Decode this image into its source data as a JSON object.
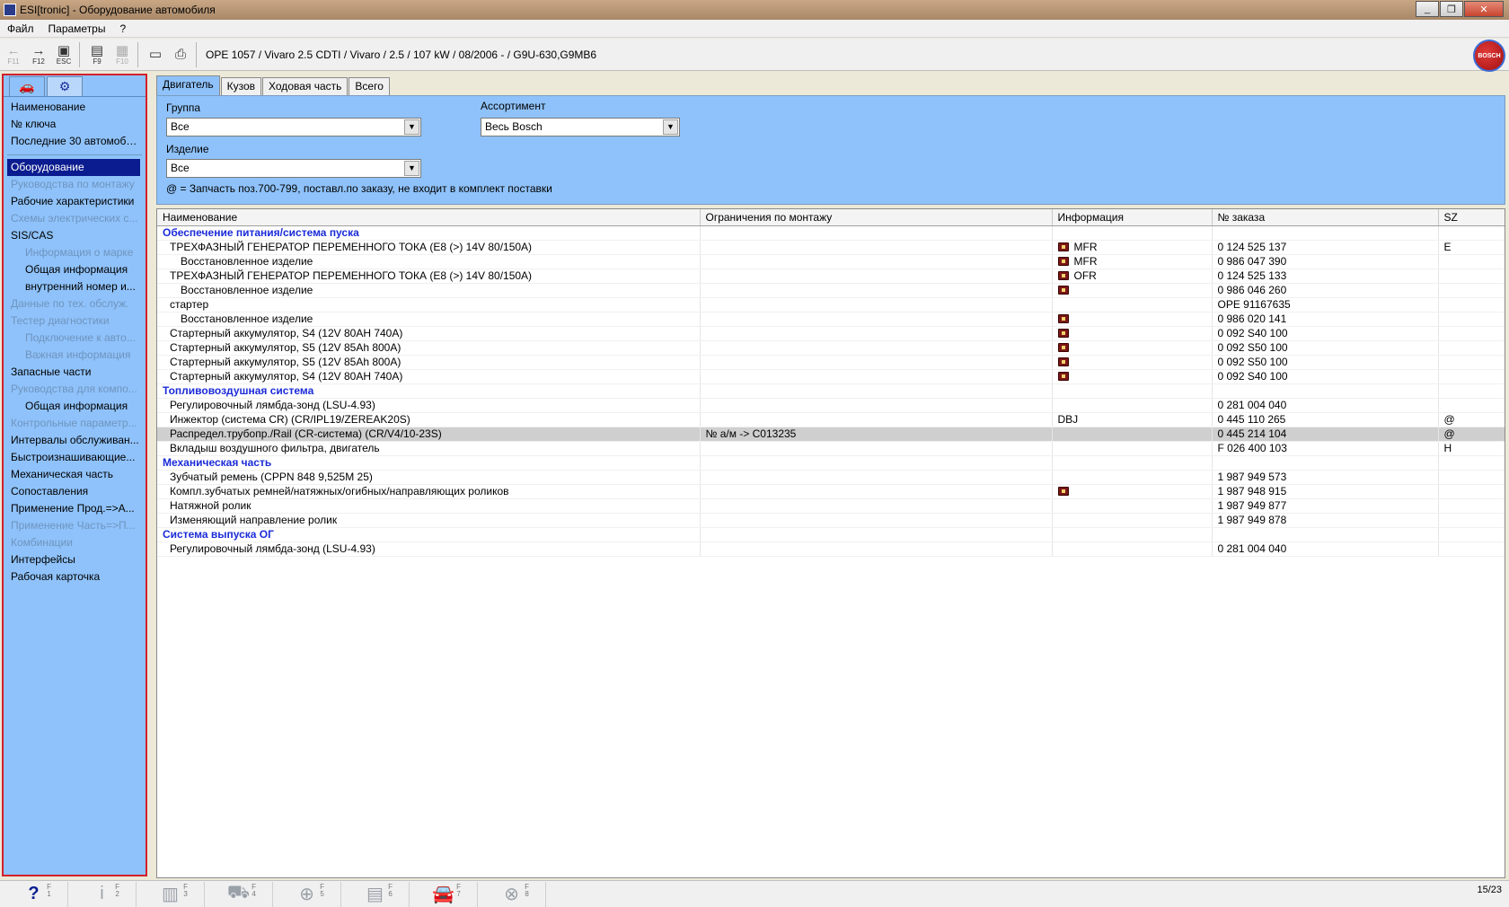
{
  "window": {
    "title": "ESI[tronic] - Оборудование автомобиля",
    "min": "_",
    "max": "❐",
    "close": "✕"
  },
  "menu": [
    "Файл",
    "Параметры",
    "?"
  ],
  "toolbar": {
    "buttons": [
      {
        "glyph": "←",
        "label": "F11",
        "disabled": true
      },
      {
        "glyph": "→",
        "label": "F12",
        "disabled": false
      },
      {
        "glyph": "▣",
        "label": "ESC",
        "disabled": false
      },
      {
        "glyph": "▤",
        "label": "F9",
        "disabled": false
      },
      {
        "glyph": "▦",
        "label": "F10",
        "disabled": true
      },
      {
        "glyph": "▭",
        "label": "",
        "disabled": false
      },
      {
        "glyph": "⎙",
        "label": "",
        "disabled": false
      }
    ],
    "vehicle": "OPE 1057 / Vivaro 2.5 CDTI / Vivaro / 2.5 / 107 kW / 08/2006 -  / G9U-630,G9MB6",
    "logo": "BOSCH"
  },
  "left_nav": {
    "tabs": [
      {
        "icon": "car-icon",
        "glyph": "🚗"
      },
      {
        "icon": "engine-icon",
        "glyph": "⚙"
      }
    ],
    "items_top": [
      {
        "label": "Наименование",
        "state": "normal"
      },
      {
        "label": "№ ключа",
        "state": "normal"
      },
      {
        "label": "Последние 30 автомоби...",
        "state": "normal"
      }
    ],
    "items": [
      {
        "label": "Оборудование",
        "state": "selected"
      },
      {
        "label": "Руководства по монтажу",
        "state": "disabled"
      },
      {
        "label": "Рабочие характеристики",
        "state": "normal"
      },
      {
        "label": "Схемы электрических с...",
        "state": "disabled"
      },
      {
        "label": "SIS/CAS",
        "state": "normal"
      },
      {
        "label": "Информация о марке",
        "state": "disabled",
        "sub": true
      },
      {
        "label": "Общая информация",
        "state": "normal",
        "sub": true
      },
      {
        "label": "внутренний номер и...",
        "state": "normal",
        "sub": true
      },
      {
        "label": "Данные по тех. обслуж.",
        "state": "disabled"
      },
      {
        "label": "Тестер диагностики",
        "state": "disabled"
      },
      {
        "label": "Подключение к авто...",
        "state": "disabled",
        "sub": true
      },
      {
        "label": "Важная информация",
        "state": "disabled",
        "sub": true
      },
      {
        "label": "Запасные части",
        "state": "normal"
      },
      {
        "label": "Руководства для компо...",
        "state": "disabled"
      },
      {
        "label": "Общая информация",
        "state": "normal",
        "sub": true
      },
      {
        "label": "Контрольные параметр...",
        "state": "disabled"
      },
      {
        "label": "Интервалы обслуживан...",
        "state": "normal"
      },
      {
        "label": "Быстроизнашивающие...",
        "state": "normal"
      },
      {
        "label": "Механическая часть",
        "state": "normal"
      },
      {
        "label": "Сопоставления",
        "state": "normal"
      },
      {
        "label": "Применение Прод.=>А...",
        "state": "normal"
      },
      {
        "label": "Применение Часть=>П...",
        "state": "disabled"
      },
      {
        "label": "Комбинации",
        "state": "disabled"
      },
      {
        "label": "Интерфейсы",
        "state": "normal"
      },
      {
        "label": "Рабочая карточка",
        "state": "normal"
      }
    ]
  },
  "main": {
    "tabs": [
      {
        "label": "Двигатель",
        "active": true
      },
      {
        "label": "Кузов",
        "active": false
      },
      {
        "label": "Ходовая часть",
        "active": false
      },
      {
        "label": "Всего",
        "active": false
      }
    ],
    "filters": {
      "group_label": "Группа",
      "group_value": "Все",
      "assortment_label": "Ассортимент",
      "assortment_value": "Весь Bosch",
      "product_label": "Изделие",
      "product_value": "Все",
      "note": "@ = Запчасть поз.700-799, поставл.по заказу, не входит в комплект поставки"
    },
    "table": {
      "columns": [
        "Наименование",
        "Ограничения по монтажу",
        "Информация",
        "№ заказа",
        "SZ"
      ],
      "rows": [
        {
          "type": "group",
          "name": "Обеспечение питания/система пуска",
          "restriction": "",
          "icon": false,
          "info": "",
          "order": "",
          "sz": ""
        },
        {
          "type": "item",
          "indent": 1,
          "name": "ТРЕХФАЗНЫЙ ГЕНЕРАТОР ПЕРЕМЕННОГО ТОКА (E8 (>) 14V 80/150A)",
          "restriction": "",
          "icon": true,
          "info": "MFR",
          "order": "0 124 525 137",
          "sz": "E"
        },
        {
          "type": "item",
          "indent": 2,
          "name": "Восстановленное изделие",
          "restriction": "",
          "icon": true,
          "info": "MFR",
          "order": "0 986 047 390",
          "sz": ""
        },
        {
          "type": "item",
          "indent": 1,
          "name": "ТРЕХФАЗНЫЙ ГЕНЕРАТОР ПЕРЕМЕННОГО ТОКА (E8 (>) 14V 80/150A)",
          "restriction": "",
          "icon": true,
          "info": "OFR",
          "order": "0 124 525 133",
          "sz": ""
        },
        {
          "type": "item",
          "indent": 2,
          "name": "Восстановленное изделие",
          "restriction": "",
          "icon": true,
          "info": "",
          "order": "0 986 046 260",
          "sz": ""
        },
        {
          "type": "item",
          "indent": 1,
          "name": "стартер",
          "restriction": "",
          "icon": false,
          "info": "",
          "order": "OPE 91167635",
          "sz": ""
        },
        {
          "type": "item",
          "indent": 2,
          "name": "Восстановленное изделие",
          "restriction": "",
          "icon": true,
          "info": "",
          "order": "0 986 020 141",
          "sz": ""
        },
        {
          "type": "item",
          "indent": 1,
          "name": "Стартерный аккумулятор, S4 (12V 80AH 740A)",
          "restriction": "",
          "icon": true,
          "info": "",
          "order": "0 092 S40 100",
          "sz": ""
        },
        {
          "type": "item",
          "indent": 1,
          "name": "Стартерный аккумулятор, S5 (12V 85Ah 800A)",
          "restriction": "",
          "icon": true,
          "info": "",
          "order": "0 092 S50 100",
          "sz": ""
        },
        {
          "type": "item",
          "indent": 1,
          "name": "Стартерный аккумулятор, S5 (12V 85Ah 800A)",
          "restriction": "",
          "icon": true,
          "info": "",
          "order": "0 092 S50 100",
          "sz": ""
        },
        {
          "type": "item",
          "indent": 1,
          "name": "Стартерный аккумулятор, S4 (12V 80AH 740A)",
          "restriction": "",
          "icon": true,
          "info": "",
          "order": "0 092 S40 100",
          "sz": ""
        },
        {
          "type": "group",
          "name": "Топливовоздушная система",
          "restriction": "",
          "icon": false,
          "info": "",
          "order": "",
          "sz": ""
        },
        {
          "type": "item",
          "indent": 1,
          "name": "Регулировочный лямбда-зонд (LSU-4.93)",
          "restriction": "",
          "icon": false,
          "info": "",
          "order": "0 281 004 040",
          "sz": ""
        },
        {
          "type": "item",
          "indent": 1,
          "name": "Инжектор (система CR) (CR/IPL19/ZEREAK20S)",
          "restriction": "",
          "icon": false,
          "info": "DBJ",
          "order": "0 445 110 265",
          "sz": "@"
        },
        {
          "type": "item",
          "indent": 1,
          "highlight": true,
          "name": "Распредел.трубопр./Rail (CR-система) (CR/V4/10-23S)",
          "restriction": "№ а/м -> C013235",
          "icon": false,
          "info": "",
          "order": "0 445 214 104",
          "sz": "@"
        },
        {
          "type": "item",
          "indent": 1,
          "name": "Вкладыш воздушного фильтра, двигатель",
          "restriction": "",
          "icon": false,
          "info": "",
          "order": "F 026 400 103",
          "sz": "H"
        },
        {
          "type": "group",
          "name": "Механическая часть",
          "restriction": "",
          "icon": false,
          "info": "",
          "order": "",
          "sz": ""
        },
        {
          "type": "item",
          "indent": 1,
          "name": "Зубчатый ремень (CPPN 848 9,525M 25)",
          "restriction": "",
          "icon": false,
          "info": "",
          "order": "1 987 949 573",
          "sz": ""
        },
        {
          "type": "item",
          "indent": 1,
          "name": "Компл.зубчатых ремней/натяжных/огибных/направляющих роликов",
          "restriction": "",
          "icon": true,
          "info": "",
          "order": "1 987 948 915",
          "sz": ""
        },
        {
          "type": "item",
          "indent": 1,
          "name": "Натяжной ролик",
          "restriction": "",
          "icon": false,
          "info": "",
          "order": "1 987 949 877",
          "sz": ""
        },
        {
          "type": "item",
          "indent": 1,
          "name": "Изменяющий направление ролик",
          "restriction": "",
          "icon": false,
          "info": "",
          "order": "1 987 949 878",
          "sz": ""
        },
        {
          "type": "group",
          "name": "Система выпуска ОГ",
          "restriction": "",
          "icon": false,
          "info": "",
          "order": "",
          "sz": ""
        },
        {
          "type": "item",
          "indent": 1,
          "name": "Регулировочный лямбда-зонд (LSU-4.93)",
          "restriction": "",
          "icon": false,
          "info": "",
          "order": "0 281 004 040",
          "sz": ""
        }
      ]
    }
  },
  "bottom": {
    "fkeys": [
      {
        "icon": "help-icon",
        "glyph": "?",
        "label": "F\n1",
        "active": true
      },
      {
        "icon": "info-icon",
        "glyph": "i",
        "label": "F\n2",
        "active": false
      },
      {
        "icon": "calculator-icon",
        "glyph": "▥",
        "label": "F\n3",
        "active": false
      },
      {
        "icon": "cart-icon",
        "glyph": "⛟",
        "label": "F\n4",
        "active": false
      },
      {
        "icon": "zoom-icon",
        "glyph": "⊕",
        "label": "F\n5",
        "active": false
      },
      {
        "icon": "list-icon",
        "glyph": "▤",
        "label": "F\n6",
        "active": false
      },
      {
        "icon": "car-icon",
        "glyph": "🚘",
        "label": "F\n7",
        "active": true
      },
      {
        "icon": "bosch-icon",
        "glyph": "⊗",
        "label": "F\n8",
        "active": false
      }
    ],
    "page_count": "15/23"
  },
  "colors": {
    "panel_blue": "#8fc2fa",
    "selection": "#0a1c8f",
    "group_text": "#1b2bd8",
    "nav_border": "#d4202a"
  }
}
